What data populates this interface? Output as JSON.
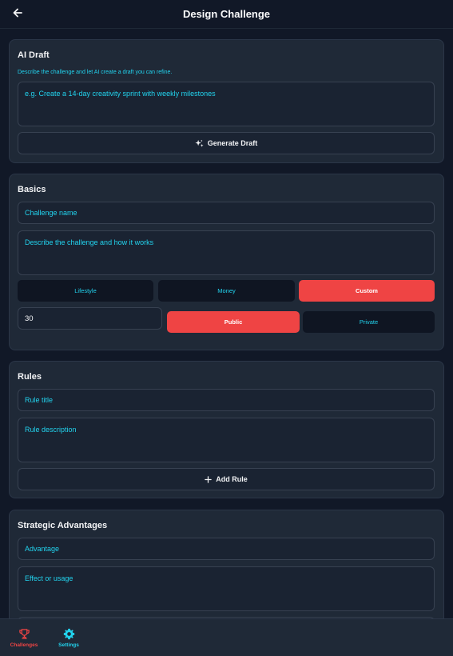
{
  "header": {
    "title": "Design Challenge"
  },
  "ai_draft": {
    "title": "AI Draft",
    "helper": "Describe the challenge and let AI create a draft you can refine.",
    "prompt_placeholder": "e.g. Create a 14-day creativity sprint with weekly milestones",
    "generate_label": "Generate Draft"
  },
  "basics": {
    "title": "Basics",
    "name_placeholder": "Challenge name",
    "description_placeholder": "Describe the challenge and how it works",
    "categories": [
      {
        "label": "Lifestyle",
        "selected": false
      },
      {
        "label": "Money",
        "selected": false
      },
      {
        "label": "Custom",
        "selected": true
      }
    ],
    "duration_value": "30",
    "visibility": [
      {
        "label": "Public",
        "selected": true
      },
      {
        "label": "Private",
        "selected": false
      }
    ]
  },
  "rules": {
    "title": "Rules",
    "rule_title_placeholder": "Rule title",
    "rule_description_placeholder": "Rule description",
    "add_rule_label": "Add Rule"
  },
  "advantages": {
    "title": "Strategic Advantages",
    "advantage_placeholder": "Advantage",
    "effect_placeholder": "Effect or usage"
  },
  "nav": {
    "items": [
      {
        "label": "Challenges",
        "icon": "trophy-icon",
        "color": "#ef4444"
      },
      {
        "label": "Settings",
        "icon": "gear-icon",
        "color": "#22d3ee"
      }
    ]
  },
  "colors": {
    "accent": "#ef4444",
    "cyan": "#22d3ee",
    "background": "#111827",
    "card": "#1f2937"
  }
}
